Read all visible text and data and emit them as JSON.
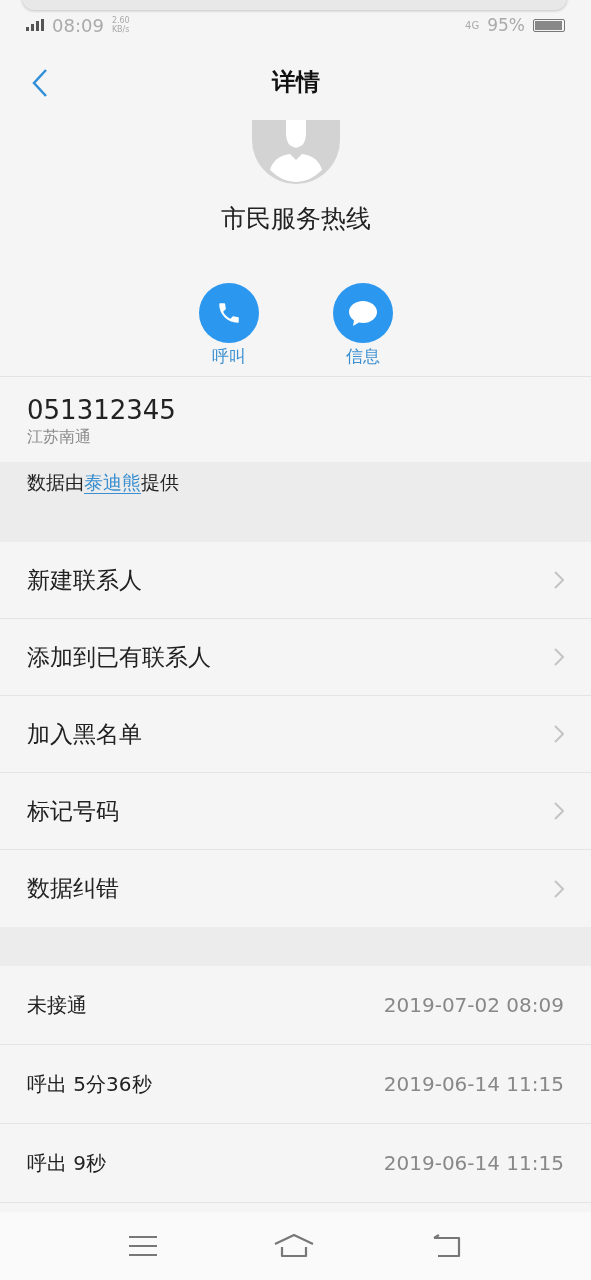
{
  "status_bar": {
    "time": "08:09",
    "speed": "2.60",
    "speed_unit": "KB/s",
    "network": "4G",
    "battery": "95%"
  },
  "header": {
    "title": "详情"
  },
  "contact": {
    "name": "市民服务热线"
  },
  "actions": [
    {
      "kind": "call",
      "label": "呼叫"
    },
    {
      "kind": "message",
      "label": "信息"
    }
  ],
  "number": {
    "value": "051312345",
    "location": "江苏南通"
  },
  "source": {
    "prefix": "数据由",
    "link": "泰迪熊",
    "suffix": "提供"
  },
  "menu": [
    {
      "label": "新建联系人"
    },
    {
      "label": "添加到已有联系人"
    },
    {
      "label": "加入黑名单"
    },
    {
      "label": "标记号码"
    },
    {
      "label": "数据纠错"
    }
  ],
  "call_log": [
    {
      "type": "未接通",
      "time": "2019-07-02 08:09"
    },
    {
      "type": "呼出 5分36秒",
      "time": "2019-06-14 11:15"
    },
    {
      "type": "呼出 9秒",
      "time": "2019-06-14 11:15"
    }
  ]
}
